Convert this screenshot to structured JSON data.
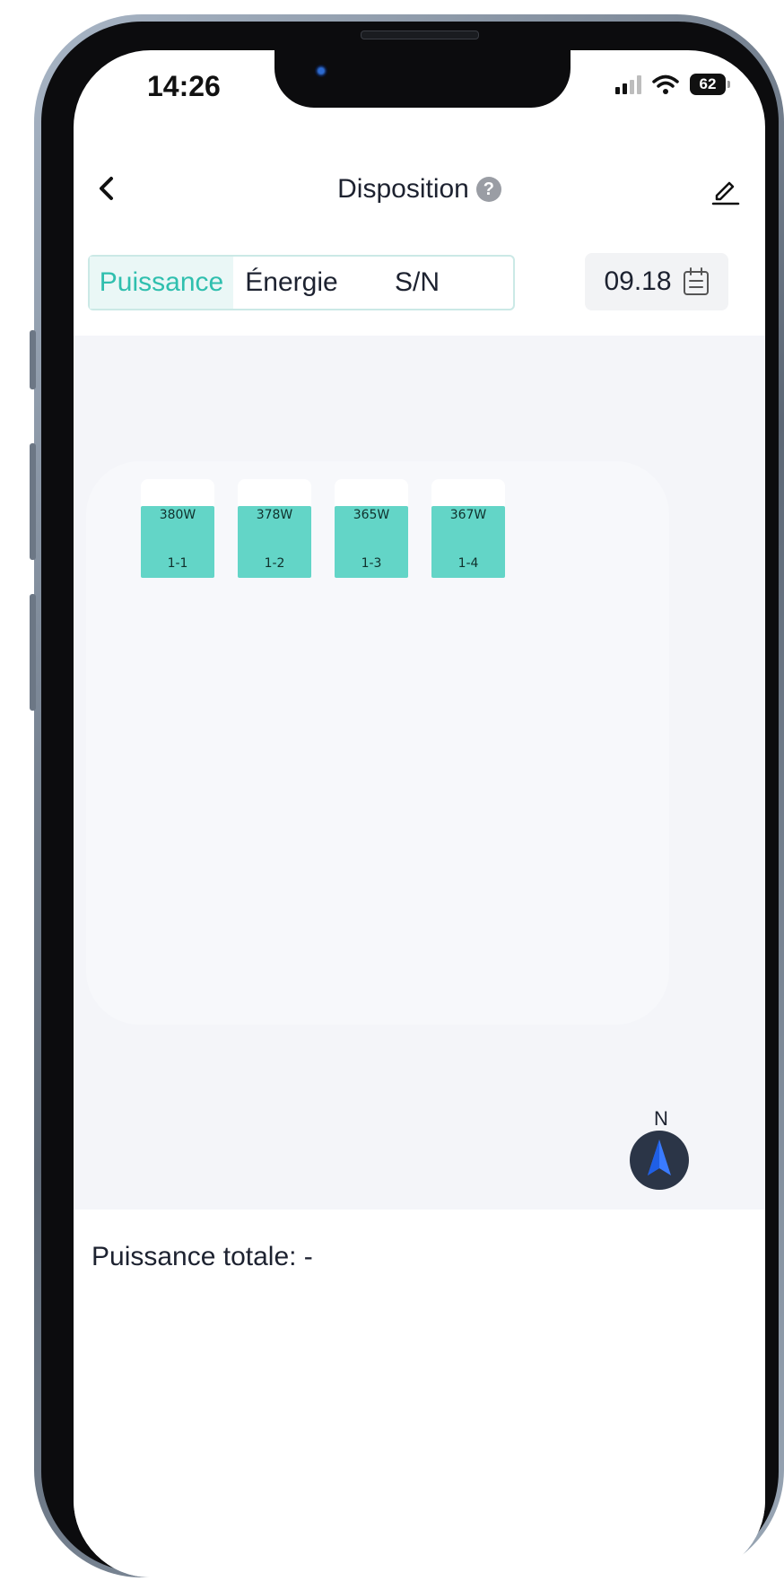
{
  "status_bar": {
    "time": "14:26",
    "battery": "62"
  },
  "nav": {
    "title": "Disposition",
    "help": "?"
  },
  "tabs": [
    {
      "label": "Puissance",
      "active": true
    },
    {
      "label": "Énergie",
      "active": false
    },
    {
      "label": "S/N",
      "active": false
    }
  ],
  "date": {
    "value": "09.18"
  },
  "modules": [
    {
      "power": "380W",
      "id": "1-1"
    },
    {
      "power": "378W",
      "id": "1-2"
    },
    {
      "power": "365W",
      "id": "1-3"
    },
    {
      "power": "367W",
      "id": "1-4"
    }
  ],
  "compass": {
    "label": "N"
  },
  "footer": {
    "total": "Puissance totale: -"
  },
  "colors": {
    "accent": "#2fbfae",
    "module": "#63d5c7",
    "canvas": "#f4f5f9"
  }
}
